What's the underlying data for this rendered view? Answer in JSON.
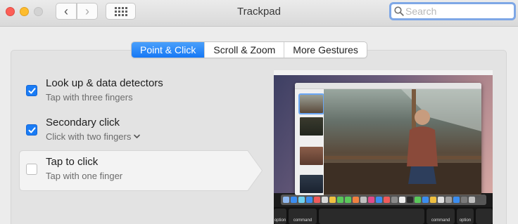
{
  "window": {
    "title": "Trackpad"
  },
  "toolbar": {
    "back_glyph": "‹",
    "forward_glyph": "›"
  },
  "search": {
    "placeholder": "Search",
    "value": ""
  },
  "tabs": [
    {
      "label": "Point & Click",
      "active": true
    },
    {
      "label": "Scroll & Zoom",
      "active": false
    },
    {
      "label": "More Gestures",
      "active": false
    }
  ],
  "options": [
    {
      "title": "Look up & data detectors",
      "subtitle": "Tap with three fingers",
      "checked": true
    },
    {
      "title": "Secondary click",
      "subtitle": "Click with two fingers",
      "checked": true,
      "has_dropdown": true
    },
    {
      "title": "Tap to click",
      "subtitle": "Tap with one finger",
      "checked": false,
      "selected": true
    }
  ],
  "preview": {
    "keys": [
      "option",
      "command",
      "command",
      "option"
    ]
  },
  "colors": {
    "accent": "#1a7cf5",
    "close": "#fc5f57",
    "minimize": "#fdbc2e",
    "search_focus": "#7ea7e6"
  },
  "icons": {
    "back": "chevron-left-icon",
    "forward": "chevron-right-icon",
    "grid": "grid-icon",
    "search": "search-icon",
    "check": "checkmark-icon",
    "dropdown": "chevron-down-icon"
  }
}
